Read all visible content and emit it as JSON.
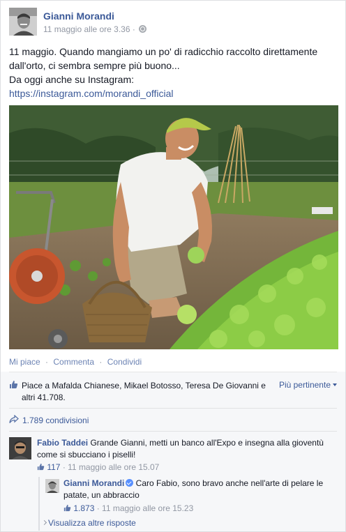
{
  "post": {
    "author": "Gianni Morandi",
    "timestamp": "11 maggio alle ore 3.36 · ",
    "audience_icon": "globe-icon",
    "text_lines": [
      "11 maggio. Quando mangiamo un po' di radicchio raccolto direttamente",
      "dall'orto, ci sembra sempre più buono...",
      "Da oggi anche su Instagram:"
    ],
    "link": "https://instagram.com/morandi_official"
  },
  "actions": {
    "like": "Mi piace",
    "comment": "Commenta",
    "share": "Condividi",
    "separator": "·"
  },
  "likes": {
    "text": "Piace a Mafalda Chianese, Mikael Botosso, Teresa De Giovanni e altri 41.708.",
    "sort_label": "Più pertinente",
    "icon": "thumbs-up-icon"
  },
  "shares": {
    "text": "1.789 condivisioni",
    "icon": "share-arrow-icon"
  },
  "comments": [
    {
      "author": "Fabio Taddei",
      "text": " Grande Gianni, metti un banco all'Expo e insegna alla gioventù come si sbucciano i piselli!",
      "likes": "117",
      "time": " · 11 maggio alle ore 15.07"
    }
  ],
  "reply": {
    "author": "Gianni Morandi",
    "text": " Caro Fabio, sono bravo anche nell'arte di pelare le patate, un abbraccio",
    "likes": "1.873",
    "time": " · 11 maggio alle ore 15.23"
  },
  "more_replies": "Visualizza altre risposte",
  "colors": {
    "link_blue": "#3b5998",
    "meta_gray": "#9197a3",
    "ufi_bg": "#f6f7f9"
  }
}
